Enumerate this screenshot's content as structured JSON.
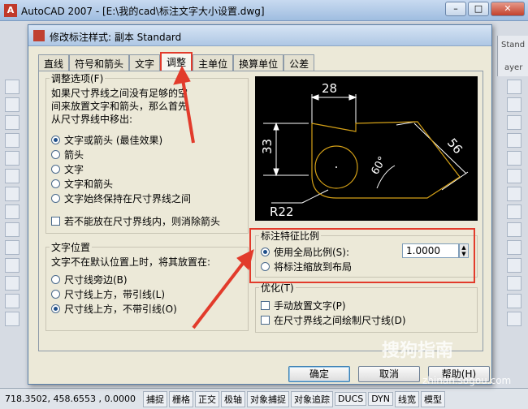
{
  "app": {
    "title": "AutoCAD 2007 - [E:\\我的cad\\标注文字大小设置.dwg]",
    "window_buttons": [
      "–",
      "□",
      "✕"
    ],
    "right_strip": {
      "stand": "Stand",
      "ayer": "ayer"
    }
  },
  "dialog": {
    "title": "修改标注样式: 副本 Standard",
    "tabs": [
      "直线",
      "符号和箭头",
      "文字",
      "调整",
      "主单位",
      "换算单位",
      "公差"
    ],
    "active_tab": "调整",
    "fit_options": {
      "legend": "调整选项(F)",
      "description": "如果尺寸界线之间没有足够的空间来放置文字和箭头，那么首先从尺寸界线中移出:",
      "desc_lines": [
        "如果尺寸界线之间没有足够的空",
        "间来放置文字和箭头，那么首先",
        "从尺寸界线中移出:"
      ],
      "options": [
        "文字或箭头 (最佳效果)",
        "箭头",
        "文字",
        "文字和箭头",
        "文字始终保持在尺寸界线之间"
      ],
      "selected": 0,
      "suppress_arrows": "若不能放在尺寸界线内，则消除箭头"
    },
    "text_placement": {
      "legend": "文字位置",
      "description": "文字不在默认位置上时，将其放置在:",
      "options": [
        "尺寸线旁边(B)",
        "尺寸线上方，带引线(L)",
        "尺寸线上方，不带引线(O)"
      ],
      "selected": 2
    },
    "scale": {
      "legend": "标注特征比例",
      "use_overall": "使用全局比例(S):",
      "overall_value": "1.0000",
      "scale_to_layout": "将标注缩放到布局"
    },
    "fine_tuning": {
      "legend": "优化(T)",
      "manual_place": "手动放置文字(P)",
      "draw_dim_line": "在尺寸界线之间绘制尺寸线(D)"
    },
    "preview": {
      "dim_top": "28",
      "dim_left": "33",
      "dim_slant": "56",
      "dim_angle": "60°",
      "dim_radius": "R22"
    },
    "buttons": {
      "ok": "确定",
      "cancel": "取消",
      "help": "帮助(H)"
    }
  },
  "statusbar": {
    "coords": "718.3502,  458.6553 , 0.0000",
    "toggles": [
      "捕捉",
      "栅格",
      "正交",
      "极轴",
      "对象捕捉",
      "对象追踪",
      "DUCS",
      "DYN",
      "线宽",
      "模型"
    ]
  },
  "watermark": {
    "text": "搜狗指南",
    "url": "zhinan.sogou.com"
  },
  "colors": {
    "highlight": "#e23b2b",
    "preview_bg": "#000000",
    "preview_shape": "#d4a017"
  }
}
